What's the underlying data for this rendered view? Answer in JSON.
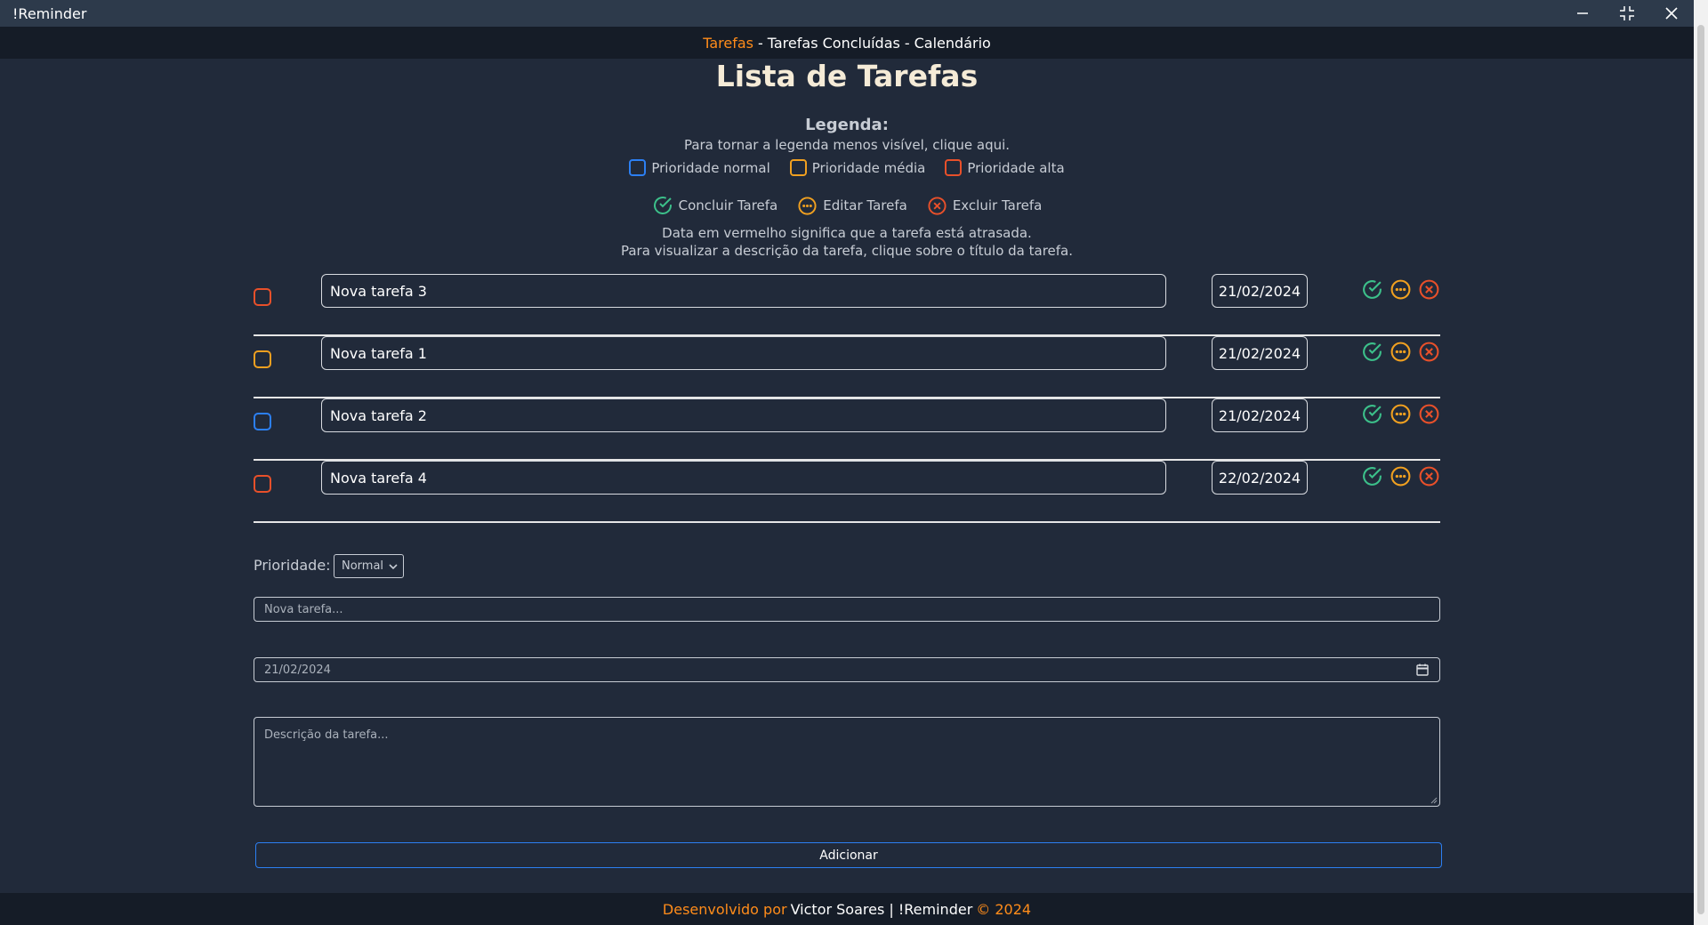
{
  "window": {
    "title": "!Reminder"
  },
  "nav": {
    "tab_tasks": "Tarefas",
    "sep1": "-",
    "tab_done": "Tarefas Concluídas",
    "sep2": "-",
    "tab_calendar": "Calendário"
  },
  "page": {
    "title": "Lista de Tarefas"
  },
  "legend": {
    "title": "Legenda:",
    "hint": "Para tornar a legenda menos visível, clique aqui.",
    "priority_normal": "Prioridade normal",
    "priority_medium": "Prioridade média",
    "priority_high": "Prioridade alta",
    "action_complete": "Concluir Tarefa",
    "action_edit": "Editar Tarefa",
    "action_delete": "Excluir Tarefa",
    "info_line1": "Data em vermelho significa que a tarefa está atrasada.",
    "info_line2": "Para visualizar a descrição da tarefa, clique sobre o título da tarefa."
  },
  "colors": {
    "priority_normal": "#2c7ff2",
    "priority_medium": "#f0a020",
    "priority_high": "#e8502a",
    "complete": "#3cc08a",
    "edit": "#f0a020",
    "delete": "#e8502a",
    "accent": "#ff8c1a"
  },
  "tasks": [
    {
      "title": "Nova tarefa 3",
      "date": "21/02/2024",
      "priority": "alta"
    },
    {
      "title": "Nova tarefa 1",
      "date": "21/02/2024",
      "priority": "media"
    },
    {
      "title": "Nova tarefa 2",
      "date": "21/02/2024",
      "priority": "normal"
    },
    {
      "title": "Nova tarefa 4",
      "date": "22/02/2024",
      "priority": "alta"
    }
  ],
  "form": {
    "priority_label": "Prioridade:",
    "priority_selected": "Normal",
    "title_placeholder": "Nova tarefa...",
    "date_value": "21/02/2024",
    "description_placeholder": "Descrição da tarefa...",
    "add_label": "Adicionar"
  },
  "footer": {
    "prefix": "Desenvolvido por",
    "author": "Victor Soares | !Reminder",
    "suffix": "© 2024"
  }
}
